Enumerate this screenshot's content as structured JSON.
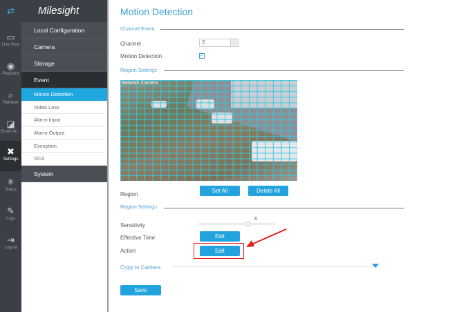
{
  "iconbar": [
    {
      "label": "",
      "icon": "swap-arrows-icon"
    },
    {
      "label": "Live View",
      "icon": "live-view-icon"
    },
    {
      "label": "Playback",
      "icon": "playback-icon"
    },
    {
      "label": "Retrieve",
      "icon": "retrieve-icon"
    },
    {
      "label": "Smart An...",
      "icon": "smart-analysis-icon"
    },
    {
      "label": "Settings",
      "icon": "settings-icon"
    },
    {
      "label": "Status",
      "icon": "status-icon"
    },
    {
      "label": "Logs",
      "icon": "logs-icon"
    },
    {
      "label": "Logout",
      "icon": "logout-icon"
    }
  ],
  "brand": "Milesight",
  "nav": {
    "items": [
      "Local Configuration",
      "Camera",
      "Storage",
      "Event"
    ],
    "sub": [
      "Motion Detection",
      "Video Loss",
      "Alarm Input",
      "Alarm Output",
      "Exception",
      "VCA"
    ],
    "system": "System"
  },
  "main": {
    "title": "Motion Detection",
    "channel_event": "Channel Event",
    "channel_label": "Channel",
    "channel_value": "2",
    "motion_label": "Motion Detection",
    "motion_checked": true,
    "region_settings": "Region Settings",
    "osd": "Network Camera",
    "region_label": "Region",
    "set_all": "Set All",
    "delete_all": "Delete All",
    "region_settings2": "Region Settings",
    "sensitivity_label": "Sensitivity",
    "sensitivity_value": "6",
    "effective_label": "Effective Time",
    "edit": "Edit",
    "action_label": "Action",
    "copy_label": "Copy to Camera",
    "save": "Save"
  },
  "colors": {
    "accent": "#23a3dd",
    "highlight": "#e0201b"
  }
}
